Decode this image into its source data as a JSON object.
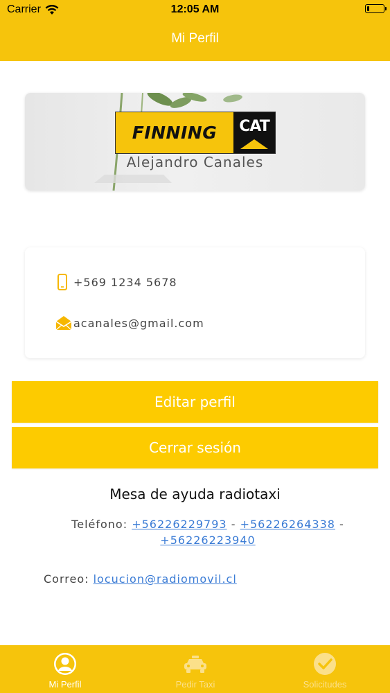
{
  "status_bar": {
    "carrier": "Carrier",
    "time": "12:05 AM"
  },
  "nav": {
    "title": "Mi Perfil"
  },
  "profile": {
    "logo_left_text": "FINNING",
    "logo_right_text": "CAT",
    "name": "Alejandro Canales"
  },
  "contact": {
    "phone": "+569 1234 5678",
    "email": "acanales@gmail.com"
  },
  "actions": {
    "edit_label": "Editar perfil",
    "logout_label": "Cerrar sesión"
  },
  "help": {
    "title": "Mesa de ayuda radiotaxi",
    "phone_label": "Teléfono:",
    "phones": [
      "+56226229793",
      "+56226264338",
      "+56226223940"
    ],
    "phone_separator": "-",
    "mail_label": "Correo:",
    "mail": "locucion@radiomovil.cl"
  },
  "tabbar": {
    "tabs": [
      {
        "label": "Mi Perfil",
        "icon": "person-icon",
        "active": true
      },
      {
        "label": "Pedir Taxi",
        "icon": "car-icon",
        "active": false
      },
      {
        "label": "Solicitudes",
        "icon": "checkmark-icon",
        "active": false
      }
    ]
  },
  "colors": {
    "brand_yellow": "#f6c40c",
    "button_yellow": "#fdcb00",
    "link_blue": "#3a7bd5"
  }
}
